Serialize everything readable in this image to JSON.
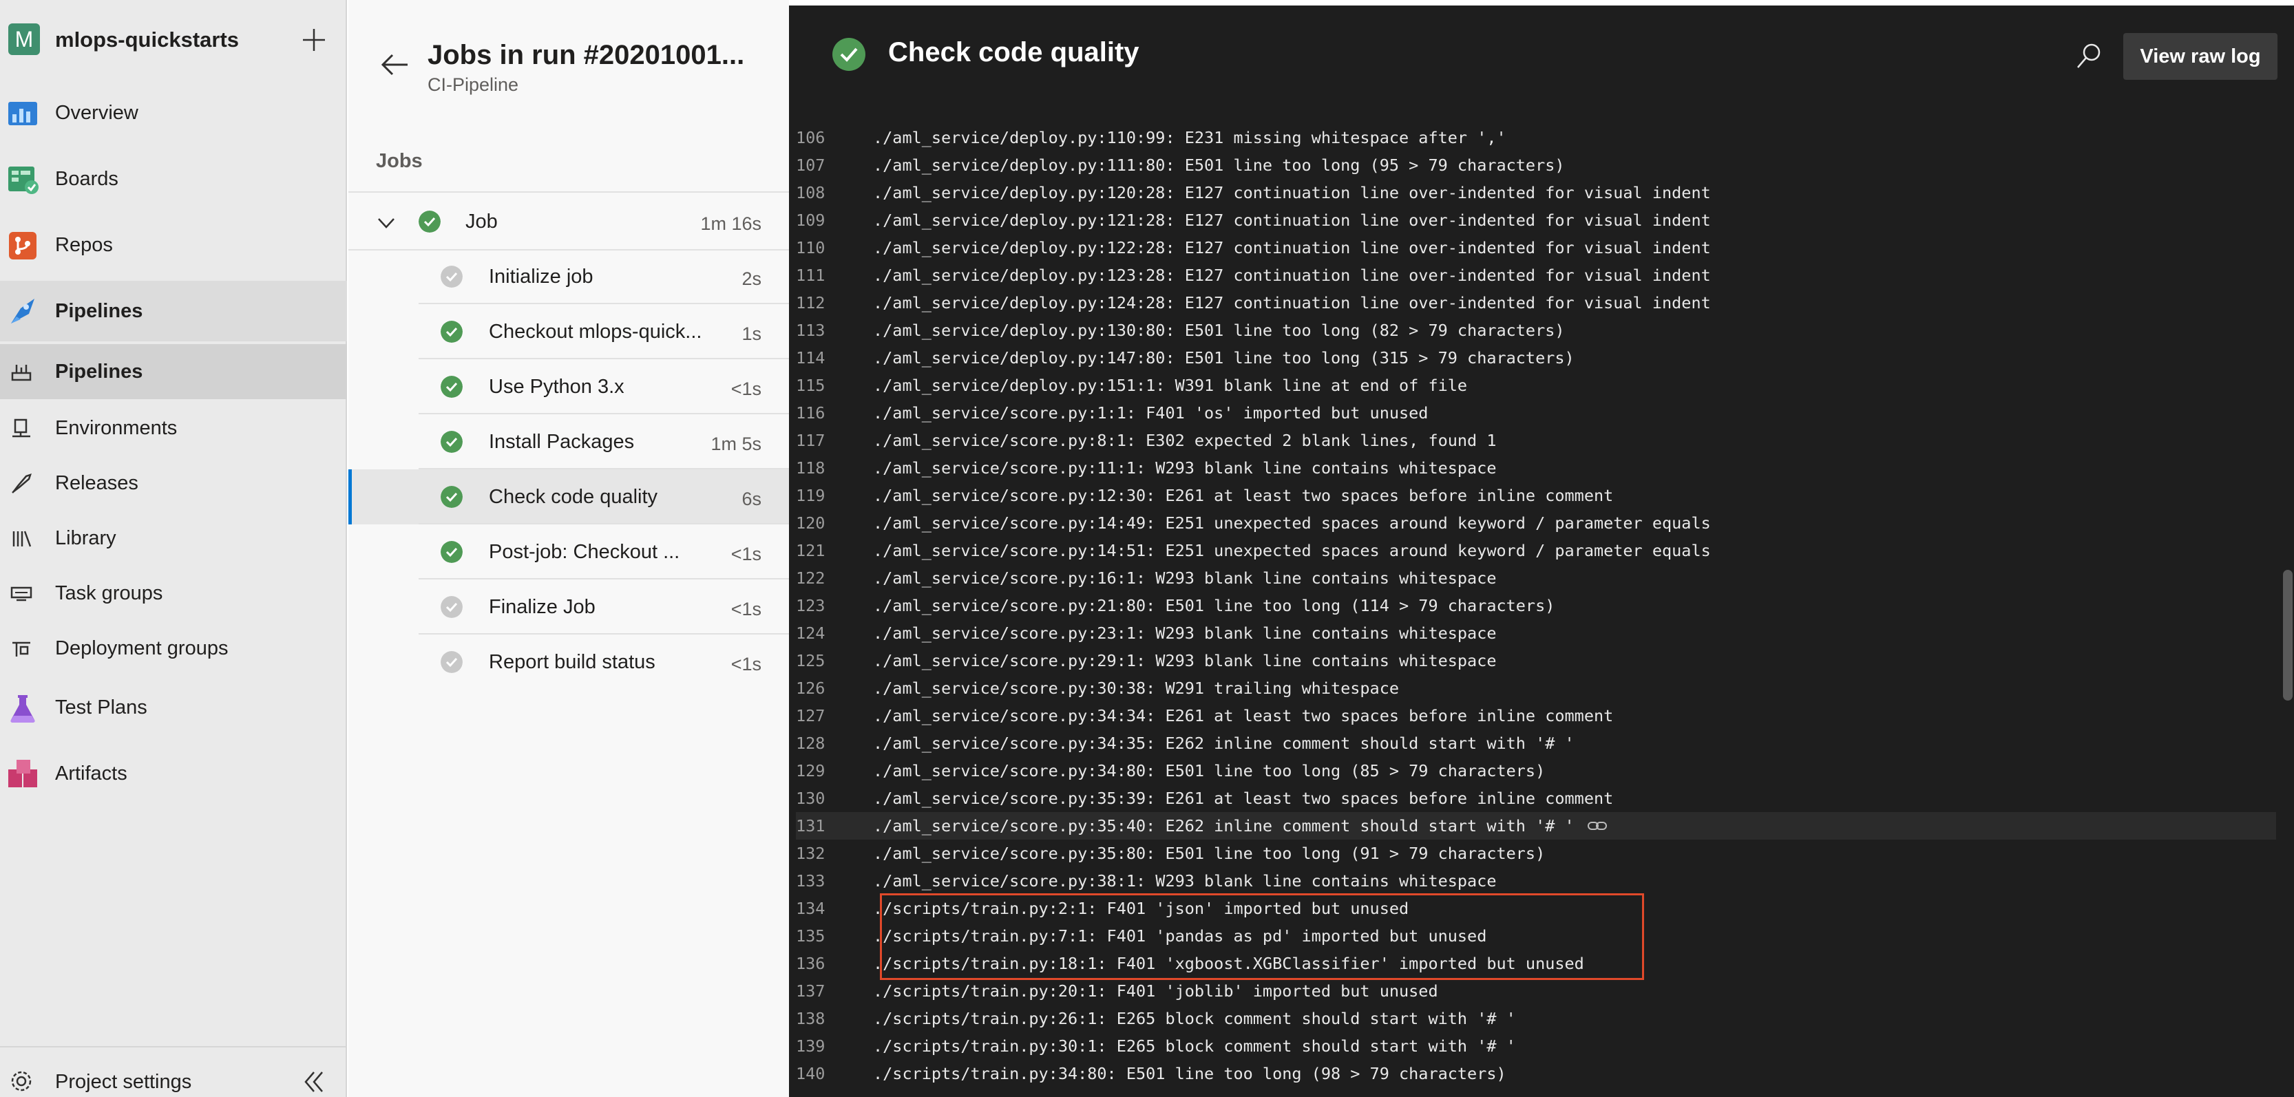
{
  "nav": {
    "project_initial": "M",
    "project_name": "mlops-quickstarts",
    "items": [
      {
        "label": "Overview",
        "icon": "overview-icon"
      },
      {
        "label": "Boards",
        "icon": "boards-icon"
      },
      {
        "label": "Repos",
        "icon": "repos-icon"
      },
      {
        "label": "Pipelines",
        "icon": "pipelines-icon"
      },
      {
        "label": "Test Plans",
        "icon": "test-plans-icon"
      },
      {
        "label": "Artifacts",
        "icon": "artifacts-icon"
      }
    ],
    "sub_items": [
      {
        "label": "Pipelines",
        "icon": "pipelines-sub-icon"
      },
      {
        "label": "Environments",
        "icon": "environments-icon"
      },
      {
        "label": "Releases",
        "icon": "releases-icon"
      },
      {
        "label": "Library",
        "icon": "library-icon"
      },
      {
        "label": "Task groups",
        "icon": "task-groups-icon"
      },
      {
        "label": "Deployment groups",
        "icon": "deployment-groups-icon"
      }
    ],
    "project_settings": "Project settings"
  },
  "jobs_panel": {
    "title": "Jobs in run #20201001...",
    "subtitle": "CI-Pipeline",
    "section_label": "Jobs",
    "job": {
      "name": "Job",
      "duration": "1m 16s"
    },
    "steps": [
      {
        "name": "Initialize job",
        "duration": "2s",
        "status": "pending"
      },
      {
        "name": "Checkout mlops-quick...",
        "duration": "1s",
        "status": "success"
      },
      {
        "name": "Use Python 3.x",
        "duration": "<1s",
        "status": "success"
      },
      {
        "name": "Install Packages",
        "duration": "1m 5s",
        "status": "success"
      },
      {
        "name": "Check code quality",
        "duration": "6s",
        "status": "success"
      },
      {
        "name": "Post-job: Checkout ...",
        "duration": "<1s",
        "status": "success"
      },
      {
        "name": "Finalize Job",
        "duration": "<1s",
        "status": "pending"
      },
      {
        "name": "Report build status",
        "duration": "<1s",
        "status": "pending"
      }
    ]
  },
  "log_panel": {
    "title": "Check code quality",
    "view_raw_label": "View raw log",
    "lines": [
      {
        "n": "106",
        "t": "./aml_service/deploy.py:110:99: E231 missing whitespace after ','"
      },
      {
        "n": "107",
        "t": "./aml_service/deploy.py:111:80: E501 line too long (95 > 79 characters)"
      },
      {
        "n": "108",
        "t": "./aml_service/deploy.py:120:28: E127 continuation line over-indented for visual indent"
      },
      {
        "n": "109",
        "t": "./aml_service/deploy.py:121:28: E127 continuation line over-indented for visual indent"
      },
      {
        "n": "110",
        "t": "./aml_service/deploy.py:122:28: E127 continuation line over-indented for visual indent"
      },
      {
        "n": "111",
        "t": "./aml_service/deploy.py:123:28: E127 continuation line over-indented for visual indent"
      },
      {
        "n": "112",
        "t": "./aml_service/deploy.py:124:28: E127 continuation line over-indented for visual indent"
      },
      {
        "n": "113",
        "t": "./aml_service/deploy.py:130:80: E501 line too long (82 > 79 characters)"
      },
      {
        "n": "114",
        "t": "./aml_service/deploy.py:147:80: E501 line too long (315 > 79 characters)"
      },
      {
        "n": "115",
        "t": "./aml_service/deploy.py:151:1: W391 blank line at end of file"
      },
      {
        "n": "116",
        "t": "./aml_service/score.py:1:1: F401 'os' imported but unused"
      },
      {
        "n": "117",
        "t": "./aml_service/score.py:8:1: E302 expected 2 blank lines, found 1"
      },
      {
        "n": "118",
        "t": "./aml_service/score.py:11:1: W293 blank line contains whitespace"
      },
      {
        "n": "119",
        "t": "./aml_service/score.py:12:30: E261 at least two spaces before inline comment"
      },
      {
        "n": "120",
        "t": "./aml_service/score.py:14:49: E251 unexpected spaces around keyword / parameter equals"
      },
      {
        "n": "121",
        "t": "./aml_service/score.py:14:51: E251 unexpected spaces around keyword / parameter equals"
      },
      {
        "n": "122",
        "t": "./aml_service/score.py:16:1: W293 blank line contains whitespace"
      },
      {
        "n": "123",
        "t": "./aml_service/score.py:21:80: E501 line too long (114 > 79 characters)"
      },
      {
        "n": "124",
        "t": "./aml_service/score.py:23:1: W293 blank line contains whitespace"
      },
      {
        "n": "125",
        "t": "./aml_service/score.py:29:1: W293 blank line contains whitespace"
      },
      {
        "n": "126",
        "t": "./aml_service/score.py:30:38: W291 trailing whitespace"
      },
      {
        "n": "127",
        "t": "./aml_service/score.py:34:34: E261 at least two spaces before inline comment"
      },
      {
        "n": "128",
        "t": "./aml_service/score.py:34:35: E262 inline comment should start with '# '"
      },
      {
        "n": "129",
        "t": "./aml_service/score.py:34:80: E501 line too long (85 > 79 characters)"
      },
      {
        "n": "130",
        "t": "./aml_service/score.py:35:39: E261 at least two spaces before inline comment"
      },
      {
        "n": "131",
        "t": "./aml_service/score.py:35:40: E262 inline comment should start with '# '"
      },
      {
        "n": "132",
        "t": "./aml_service/score.py:35:80: E501 line too long (91 > 79 characters)"
      },
      {
        "n": "133",
        "t": "./aml_service/score.py:38:1: W293 blank line contains whitespace"
      },
      {
        "n": "134",
        "t": "./scripts/train.py:2:1: F401 'json' imported but unused"
      },
      {
        "n": "135",
        "t": "./scripts/train.py:7:1: F401 'pandas as pd' imported but unused"
      },
      {
        "n": "136",
        "t": "./scripts/train.py:18:1: F401 'xgboost.XGBClassifier' imported but unused"
      },
      {
        "n": "137",
        "t": "./scripts/train.py:20:1: F401 'joblib' imported but unused"
      },
      {
        "n": "138",
        "t": "./scripts/train.py:26:1: E265 block comment should start with '# '"
      },
      {
        "n": "139",
        "t": "./scripts/train.py:30:1: E265 block comment should start with '# '"
      },
      {
        "n": "140",
        "t": "./scripts/train.py:34:80: E501 line too long (98 > 79 characters)"
      }
    ]
  },
  "colors": {
    "success": "#4f9a55",
    "pending": "#c8c8c8",
    "accent": "#0078d4",
    "highlight_box": "#e0492a"
  }
}
